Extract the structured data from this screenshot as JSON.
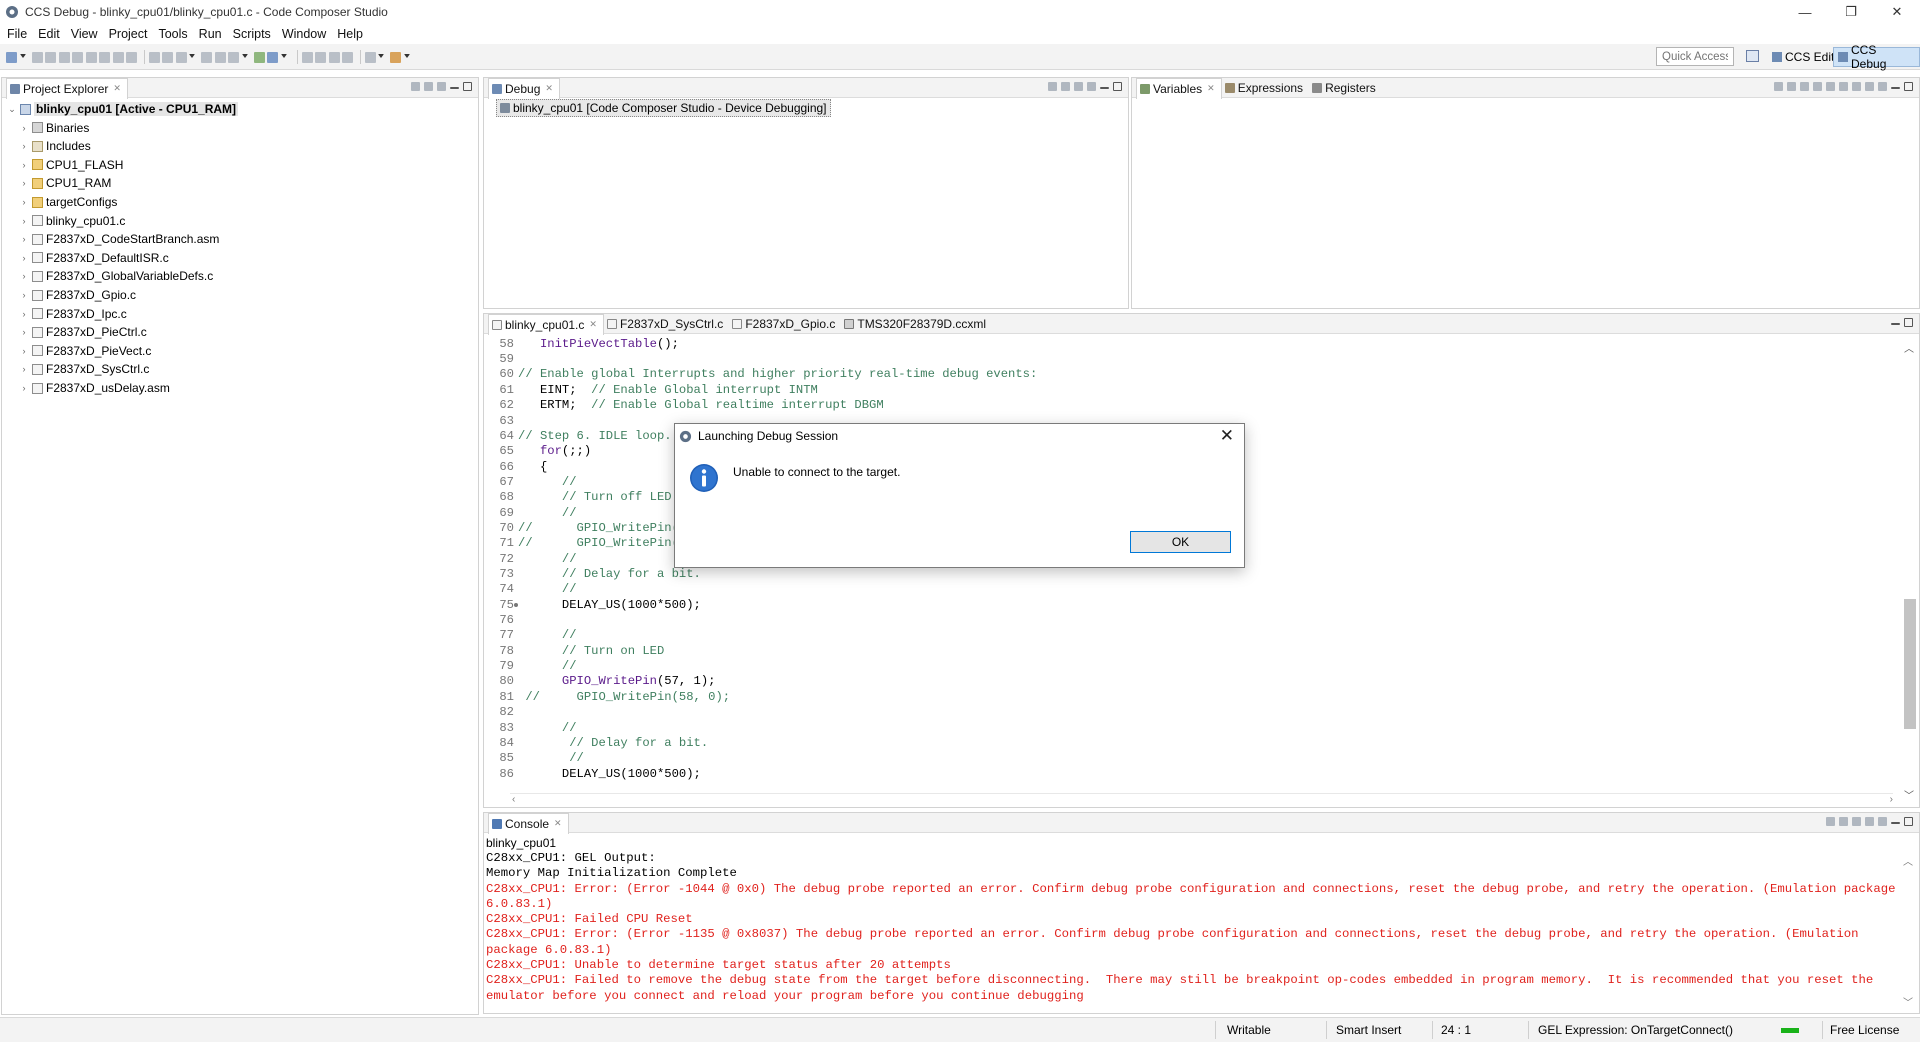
{
  "window": {
    "title": "CCS Debug - blinky_cpu01/blinky_cpu01.c - Code Composer Studio",
    "buttons": [
      "—",
      "❐",
      "✕"
    ]
  },
  "menu": [
    "File",
    "Edit",
    "View",
    "Project",
    "Tools",
    "Run",
    "Scripts",
    "Window",
    "Help"
  ],
  "toolbar": {
    "quick_access_placeholder": "Quick Access",
    "perspectives": [
      "CCS Edit",
      "CCS Debug"
    ]
  },
  "project_explorer": {
    "tab": "Project Explorer",
    "items": [
      {
        "label": "blinky_cpu01  [Active - CPU1_RAM]",
        "icon": "project-icon",
        "expanded": true
      },
      {
        "label": "Binaries",
        "icon": "binaries-icon"
      },
      {
        "label": "Includes",
        "icon": "includes-icon"
      },
      {
        "label": "CPU1_FLASH",
        "icon": "folder-icon"
      },
      {
        "label": "CPU1_RAM",
        "icon": "folder-icon"
      },
      {
        "label": "targetConfigs",
        "icon": "folder-icon"
      },
      {
        "label": "blinky_cpu01.c",
        "icon": "c-file-icon"
      },
      {
        "label": "F2837xD_CodeStartBranch.asm",
        "icon": "asm-file-icon"
      },
      {
        "label": "F2837xD_DefaultISR.c",
        "icon": "c-file-icon"
      },
      {
        "label": "F2837xD_GlobalVariableDefs.c",
        "icon": "c-file-icon"
      },
      {
        "label": "F2837xD_Gpio.c",
        "icon": "c-file-icon"
      },
      {
        "label": "F2837xD_Ipc.c",
        "icon": "c-file-icon"
      },
      {
        "label": "F2837xD_PieCtrl.c",
        "icon": "c-file-icon"
      },
      {
        "label": "F2837xD_PieVect.c",
        "icon": "c-file-icon"
      },
      {
        "label": "F2837xD_SysCtrl.c",
        "icon": "c-file-icon"
      },
      {
        "label": "F2837xD_usDelay.asm",
        "icon": "asm-file-icon"
      }
    ]
  },
  "debug_view": {
    "tab": "Debug",
    "session": "blinky_cpu01 [Code Composer Studio - Device Debugging]"
  },
  "variables_view": {
    "tabs": [
      "Variables",
      "Expressions",
      "Registers"
    ]
  },
  "editor": {
    "tabs": [
      "blinky_cpu01.c",
      "F2837xD_SysCtrl.c",
      "F2837xD_Gpio.c",
      "TMS320F28379D.ccxml"
    ],
    "lines": [
      {
        "n": "58",
        "segs": [
          [
            "   ",
            "norm"
          ],
          [
            "InitPieVectTable",
            "func"
          ],
          [
            "();",
            "norm"
          ]
        ]
      },
      {
        "n": "59",
        "segs": [
          [
            "",
            "norm"
          ]
        ]
      },
      {
        "n": "60",
        "segs": [
          [
            "// Enable global Interrupts and higher priority real-time debug events:",
            "comment"
          ]
        ]
      },
      {
        "n": "61",
        "segs": [
          [
            "   EINT;  ",
            "norm"
          ],
          [
            "// Enable Global interrupt INTM",
            "comment"
          ]
        ]
      },
      {
        "n": "62",
        "segs": [
          [
            "   ERTM;  ",
            "norm"
          ],
          [
            "// Enable Global realtime interrupt DBGM",
            "comment"
          ]
        ]
      },
      {
        "n": "63",
        "segs": [
          [
            "",
            "norm"
          ]
        ]
      },
      {
        "n": "64",
        "segs": [
          [
            "// Step 6. IDLE loop. J",
            "comment"
          ]
        ]
      },
      {
        "n": "65",
        "segs": [
          [
            "   ",
            "norm"
          ],
          [
            "for",
            "func"
          ],
          [
            "(;;)",
            "norm"
          ]
        ]
      },
      {
        "n": "66",
        "segs": [
          [
            "   {",
            "norm"
          ]
        ]
      },
      {
        "n": "67",
        "segs": [
          [
            "      //",
            "comment"
          ]
        ]
      },
      {
        "n": "68",
        "segs": [
          [
            "      // Turn off LED",
            "comment"
          ]
        ]
      },
      {
        "n": "69",
        "segs": [
          [
            "      //",
            "comment"
          ]
        ]
      },
      {
        "n": "70",
        "segs": [
          [
            "//      GPIO_WritePin(5",
            "comment"
          ]
        ]
      },
      {
        "n": "71",
        "segs": [
          [
            "//      GPIO_WritePin(5",
            "comment"
          ]
        ]
      },
      {
        "n": "72",
        "segs": [
          [
            "      //",
            "comment"
          ]
        ]
      },
      {
        "n": "73",
        "segs": [
          [
            "      // Delay for a bit.",
            "comment"
          ]
        ]
      },
      {
        "n": "74",
        "segs": [
          [
            "      //",
            "comment"
          ]
        ]
      },
      {
        "n": "75",
        "marker": true,
        "segs": [
          [
            "      DELAY_US(1000*500);",
            "norm"
          ]
        ]
      },
      {
        "n": "76",
        "segs": [
          [
            "",
            "norm"
          ]
        ]
      },
      {
        "n": "77",
        "segs": [
          [
            "      //",
            "comment"
          ]
        ]
      },
      {
        "n": "78",
        "segs": [
          [
            "      // Turn on LED",
            "comment"
          ]
        ]
      },
      {
        "n": "79",
        "segs": [
          [
            "      //",
            "comment"
          ]
        ]
      },
      {
        "n": "80",
        "segs": [
          [
            "      ",
            "norm"
          ],
          [
            "GPIO_WritePin",
            "func"
          ],
          [
            "(57, 1);",
            "norm"
          ]
        ]
      },
      {
        "n": "81",
        "segs": [
          [
            " //     GPIO_WritePin(58, 0);",
            "comment"
          ]
        ]
      },
      {
        "n": "82",
        "segs": [
          [
            "",
            "norm"
          ]
        ]
      },
      {
        "n": "83",
        "segs": [
          [
            "      //",
            "comment"
          ]
        ]
      },
      {
        "n": "84",
        "segs": [
          [
            "       // Delay for a bit.",
            "comment"
          ]
        ]
      },
      {
        "n": "85",
        "segs": [
          [
            "       //",
            "comment"
          ]
        ]
      },
      {
        "n": "86",
        "segs": [
          [
            "      DELAY_US(1000*500);",
            "norm"
          ]
        ]
      }
    ]
  },
  "console": {
    "tab": "Console",
    "name": "blinky_cpu01",
    "lines": [
      {
        "text": "C28xx_CPU1: GEL Output:",
        "type": "out"
      },
      {
        "text": "Memory Map Initialization Complete",
        "type": "out"
      },
      {
        "text": "C28xx_CPU1: Error: (Error -1044 @ 0x0) The debug probe reported an error. Confirm debug probe configuration and connections, reset the debug probe, and retry the operation. (Emulation package 6.0.83.1)",
        "type": "err"
      },
      {
        "text": "C28xx_CPU1: Failed CPU Reset",
        "type": "err"
      },
      {
        "text": "C28xx_CPU1: Error: (Error -1135 @ 0x8037) The debug probe reported an error. Confirm debug probe configuration and connections, reset the debug probe, and retry the operation. (Emulation package 6.0.83.1)",
        "type": "err"
      },
      {
        "text": "C28xx_CPU1: Unable to determine target status after 20 attempts",
        "type": "err"
      },
      {
        "text": "C28xx_CPU1: Failed to remove the debug state from the target before disconnecting.  There may still be breakpoint op-codes embedded in program memory.  It is recommended that you reset the emulator before you connect and reload your program before you continue debugging",
        "type": "err"
      }
    ]
  },
  "status": {
    "writable": "Writable",
    "insert_mode": "Smart Insert",
    "position": "24 : 1",
    "gel": "GEL Expression: OnTargetConnect()",
    "license": "Free License"
  },
  "dialog": {
    "title": "Launching Debug Session",
    "message": "Unable to connect to the target.",
    "ok_label": "OK",
    "close": "✕"
  },
  "colors": {
    "error_text": "#e0221d",
    "comment": "#3f7f5f",
    "keyword": "#5a1a8a",
    "selection": "#cfe3f7"
  }
}
